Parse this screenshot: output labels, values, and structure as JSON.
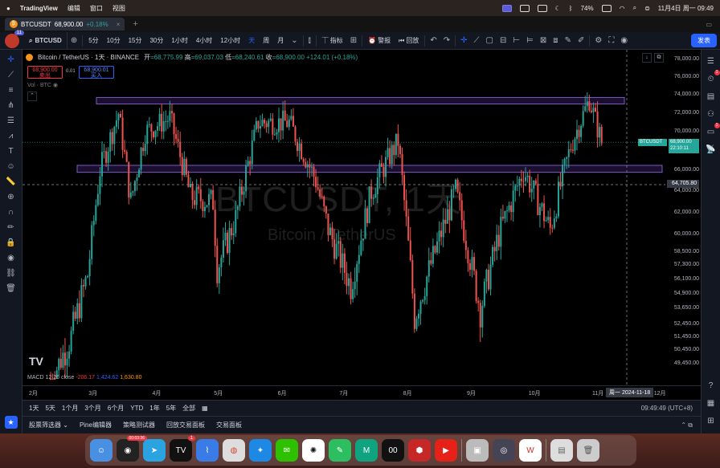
{
  "menubar": {
    "app": "TradingView",
    "items": [
      "编辑",
      "窗口",
      "视图"
    ],
    "battery": "74%",
    "datetime": "11月4日 周一 09:49"
  },
  "browser_tab": {
    "title": "BTCUSDT",
    "price": "68,900.00",
    "change": "+0.18%"
  },
  "toolbar": {
    "avatar_badge": "11",
    "symbol": "BTCUSD",
    "intervals": [
      "5分",
      "10分",
      "15分",
      "30分",
      "1小时",
      "4小时",
      "12小时",
      "天",
      "周",
      "月"
    ],
    "active_interval": "天",
    "indicators_label": "指标",
    "alert_label": "警报",
    "replay_label": "回放",
    "publish_label": "发表"
  },
  "legend": {
    "title": "Bitcoin / TetherUS · 1天 · BINANCE",
    "open_label": "开",
    "open": "=68,775.99",
    "high_label": "高",
    "high": "=69,037.03",
    "low_label": "低",
    "low": "=68,240.61",
    "close_label": "收",
    "close": "=68,900.00",
    "change": "+124.01 (+0.18%)",
    "sell_price": "68,900.00",
    "sell_label": "卖出",
    "spread": "0.01",
    "buy_price": "68,900.01",
    "buy_label": "买入",
    "vol": "Vol · BTC"
  },
  "watermark": {
    "line1": "BTCUSDT, 1天",
    "line2": "Bitcoin / TetherUS"
  },
  "macd": {
    "label": "MACD 12 26 close",
    "v1": "-206.17",
    "v2": "1,424.62",
    "v3": "1,630.80"
  },
  "price_axis": [
    "78,000.00",
    "76,000.00",
    "74,000.00",
    "72,000.00",
    "70,000.00",
    "66,000.00",
    "64,000.00",
    "62,000.00",
    "60,000.00",
    "58,500.00",
    "57,300.00",
    "56,100.00",
    "54,900.00",
    "53,650.00",
    "52,450.00",
    "51,450.00",
    "50,450.00",
    "49,450.00"
  ],
  "last_tag": "BTCUSDT",
  "last_price": "68,900.00",
  "last_countdown": "22:10:11",
  "cross_price": "64,705.80",
  "time_axis": [
    "2月",
    "3月",
    "4月",
    "5月",
    "6月",
    "7月",
    "8月",
    "9月",
    "10月",
    "11月",
    "12月"
  ],
  "cross_date": "周一 2024-11-18",
  "ranges": [
    "1天",
    "5天",
    "1个月",
    "3个月",
    "6个月",
    "YTD",
    "1年",
    "5年",
    "全部"
  ],
  "clock": "09:49:49 (UTC+8)",
  "panels": [
    "股票筛选器",
    "Pine编辑器",
    "策略测试器",
    "回放交易面板",
    "交易面板"
  ],
  "right_badges": {
    "alerts": "1",
    "chat": "1"
  },
  "dock": {
    "timer_badge": "00:03:36",
    "tv_badge": "1",
    "app_names": [
      "finder",
      "recorder",
      "telegram",
      "tradingview",
      "dna",
      "chrome",
      "safari",
      "wechat",
      "chatgpt",
      "evernote",
      "mnote",
      "clock-00",
      "nba",
      "youtube",
      "preview",
      "quicktime",
      "wps",
      "archive",
      "trash"
    ]
  },
  "chart_data": {
    "type": "candlestick",
    "symbol": "BTCUSDT",
    "interval": "1D",
    "x_range": [
      "2024-02",
      "2024-12"
    ],
    "y_range": [
      49450,
      78000
    ],
    "x_ticks": [
      "2月",
      "3月",
      "4月",
      "5月",
      "6月",
      "7月",
      "8月",
      "9月",
      "10月",
      "11月",
      "12月"
    ],
    "resistance_zone": [
      73000,
      73700
    ],
    "support_zone": [
      65800,
      66500
    ],
    "close_series": [
      [
        "2024-02-10",
        48000
      ],
      [
        "2024-02-20",
        51500
      ],
      [
        "2024-02-28",
        56500
      ],
      [
        "2024-03-05",
        66000
      ],
      [
        "2024-03-14",
        72000
      ],
      [
        "2024-03-20",
        63000
      ],
      [
        "2024-03-27",
        70000
      ],
      [
        "2024-04-08",
        71500
      ],
      [
        "2024-04-18",
        63500
      ],
      [
        "2024-04-29",
        63000
      ],
      [
        "2024-05-01",
        57000
      ],
      [
        "2024-05-10",
        61500
      ],
      [
        "2024-05-21",
        71000
      ],
      [
        "2024-06-05",
        71000
      ],
      [
        "2024-06-18",
        65000
      ],
      [
        "2024-06-24",
        60500
      ],
      [
        "2024-07-05",
        55500
      ],
      [
        "2024-07-15",
        64000
      ],
      [
        "2024-07-28",
        69000
      ],
      [
        "2024-08-05",
        53000
      ],
      [
        "2024-08-15",
        58500
      ],
      [
        "2024-08-25",
        64000
      ],
      [
        "2024-09-06",
        53500
      ],
      [
        "2024-09-15",
        60000
      ],
      [
        "2024-09-27",
        66000
      ],
      [
        "2024-10-10",
        60500
      ],
      [
        "2024-10-20",
        68500
      ],
      [
        "2024-10-29",
        73500
      ],
      [
        "2024-11-04",
        68900
      ]
    ]
  }
}
